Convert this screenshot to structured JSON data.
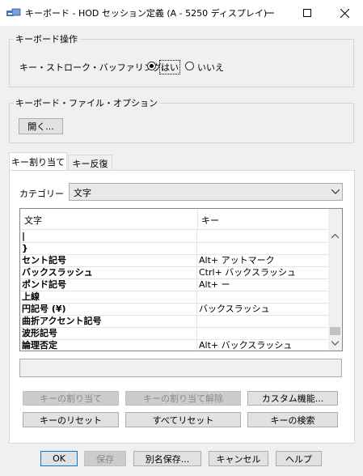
{
  "window": {
    "title": "キーボード - HOD セッション定義 (A - 5250 ディスプレイ)",
    "minimize_glyph": "—",
    "maximize_glyph": "☐",
    "close_glyph": "✕"
  },
  "keyboard_ops": {
    "group_label": "キーボード操作",
    "buffering_label": "キー・ストローク・バッファリング:",
    "yes_label": "はい",
    "no_label": "いいえ",
    "selected": "yes"
  },
  "keyboard_file": {
    "group_label": "キーボード・ファイル・オプション",
    "open_label": "開く..."
  },
  "tabs": [
    {
      "label": "キー割り当て",
      "active": true
    },
    {
      "label": "キー反復",
      "active": false
    }
  ],
  "category": {
    "label": "カテゴリー",
    "value": "文字"
  },
  "table": {
    "col_char": "文字",
    "col_key": "キー",
    "rows": [
      {
        "char": "|",
        "key": ""
      },
      {
        "char": "}",
        "key": ""
      },
      {
        "char": "セント記号",
        "key": "Alt+ アットマーク"
      },
      {
        "char": "バックスラッシュ",
        "key": "Ctrl+ バックスラッシュ"
      },
      {
        "char": "ポンド記号",
        "key": "Alt+ ー"
      },
      {
        "char": "上線",
        "key": ""
      },
      {
        "char": "円記号 (¥)",
        "key": "バックスラッシュ"
      },
      {
        "char": "曲折アクセント記号",
        "key": ""
      },
      {
        "char": "波形記号",
        "key": ""
      },
      {
        "char": "論理否定",
        "key": "Alt+ バックスラッシュ"
      }
    ]
  },
  "description": "",
  "buttons": {
    "assign": "キーの割り当て",
    "unassign": "キーの割り当て解除",
    "custom": "カスタム機能...",
    "reset_key": "キーのリセット",
    "reset_all": "すべてリセット",
    "search": "キーの検索"
  },
  "footer": {
    "ok": "OK",
    "save": "保存",
    "save_as": "別名保存...",
    "cancel": "キャンセル",
    "help": "ヘルプ"
  }
}
